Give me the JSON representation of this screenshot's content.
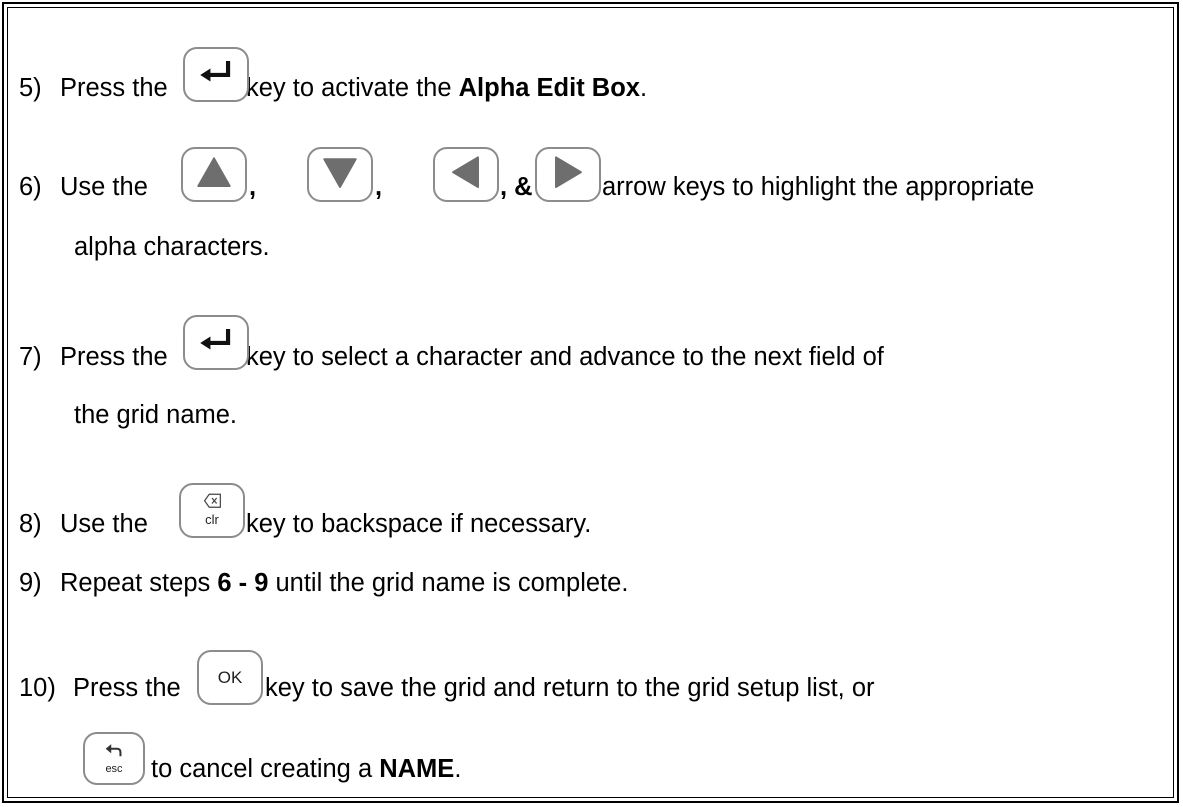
{
  "steps": [
    {
      "num": "5)",
      "pre": "Press the",
      "key": "enter",
      "post": "key to activate the ",
      "bold": "Alpha Edit Box",
      "end": "."
    },
    {
      "num": "6)",
      "pre": "Use the",
      "keys": [
        "up",
        "down",
        "left",
        "right"
      ],
      "sep1": ",",
      "sep2": ",",
      "sep3": ", &",
      "post": "arrow keys to highlight the appropriate",
      "cont": "alpha characters."
    },
    {
      "num": "7)",
      "pre": "Press the",
      "key": "enter",
      "post": "key to select a character and advance to the next field of",
      "cont": "the grid name."
    },
    {
      "num": "8)",
      "pre": "Use the",
      "key": "clr",
      "key_label": "clr",
      "post": "key to backspace if necessary."
    },
    {
      "num": "9)",
      "pre": "Repeat steps ",
      "bold": "6 - 9",
      "post": " until the grid name is complete."
    },
    {
      "num": "10)",
      "pre": "Press the",
      "key": "ok",
      "key_label": "OK",
      "post": "key to save the grid and return to the grid setup list, or",
      "esc_label": "esc",
      "cont_pre": "to cancel creating a ",
      "cont_bold": "NAME",
      "cont_end": "."
    }
  ],
  "icons": {
    "enter": "enter-arrow-icon",
    "up": "triangle-up-icon",
    "down": "triangle-down-icon",
    "left": "triangle-left-icon",
    "right": "triangle-right-icon",
    "clr": "backspace-icon",
    "esc": "return-arrow-icon"
  },
  "colors": {
    "key_border": "#8c8c8c",
    "arrow_fill": "#6e6e6e",
    "text": "#000000"
  }
}
